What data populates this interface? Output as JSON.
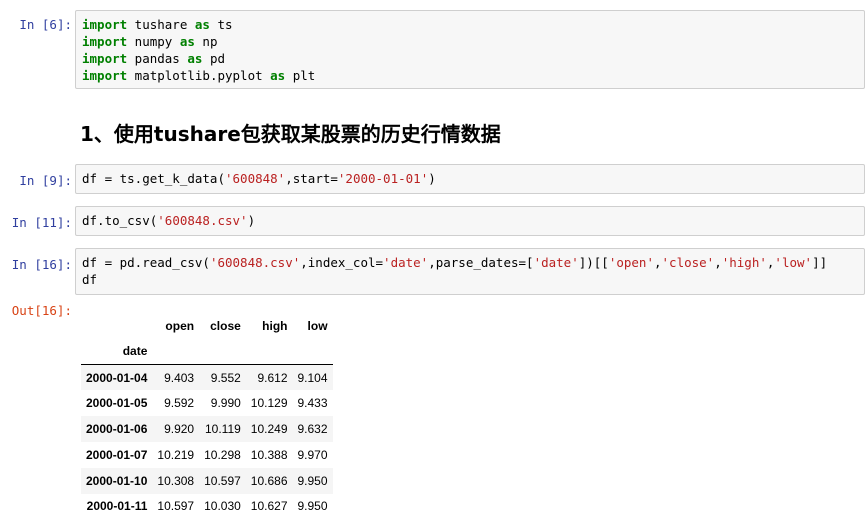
{
  "cells": [
    {
      "prompt": "In [6]:",
      "lines": [
        [
          "import",
          " tushare ",
          "as",
          " ts"
        ],
        [
          "import",
          " numpy ",
          "as",
          " np"
        ],
        [
          "import",
          " pandas ",
          "as",
          " pd"
        ],
        [
          "import",
          " matplotlib.pyplot ",
          "as",
          " plt"
        ]
      ]
    },
    {
      "prompt": "In [9]:",
      "code": {
        "p1": "df = ts.get_k_data(",
        "s1": "'600848'",
        "p2": ",start=",
        "s2": "'2000-01-01'",
        "p3": ")"
      }
    },
    {
      "prompt": "In [11]:",
      "code": {
        "p1": "df.to_csv(",
        "s1": "'600848.csv'",
        "p2": ")"
      }
    },
    {
      "prompt": "In [16]:",
      "code": {
        "p1": "df = pd.read_csv(",
        "s1": "'600848.csv'",
        "p2": ",index_col=",
        "s2": "'date'",
        "p3": ",parse_dates=[",
        "s3": "'date'",
        "p4": "])[[",
        "s4": "'open'",
        "p5": ",",
        "s5": "'close'",
        "p6": ",",
        "s6": "'high'",
        "p7": ",",
        "s7": "'low'",
        "p8": "]]",
        "line2": "df"
      }
    }
  ],
  "heading": "1、使用tushare包获取某股票的历史行情数据",
  "output": {
    "prompt": "Out[16]:",
    "columns": [
      "open",
      "close",
      "high",
      "low"
    ],
    "index_name": "date",
    "rows": [
      {
        "date": "2000-01-04",
        "open": "9.403",
        "close": "9.552",
        "high": "9.612",
        "low": "9.104"
      },
      {
        "date": "2000-01-05",
        "open": "9.592",
        "close": "9.990",
        "high": "10.129",
        "low": "9.433"
      },
      {
        "date": "2000-01-06",
        "open": "9.920",
        "close": "10.119",
        "high": "10.249",
        "low": "9.632"
      },
      {
        "date": "2000-01-07",
        "open": "10.219",
        "close": "10.298",
        "high": "10.388",
        "low": "9.970"
      },
      {
        "date": "2000-01-10",
        "open": "10.308",
        "close": "10.597",
        "high": "10.686",
        "low": "9.950"
      },
      {
        "date": "2000-01-11",
        "open": "10.597",
        "close": "10.030",
        "high": "10.627",
        "low": "9.950"
      }
    ]
  },
  "colors": {
    "keyword": "#008000",
    "string": "#ba2121",
    "in_prompt": "#303f9f",
    "out_prompt": "#d84315",
    "cell_bg": "#f7f7f7",
    "cell_border": "#cfcfcf"
  }
}
